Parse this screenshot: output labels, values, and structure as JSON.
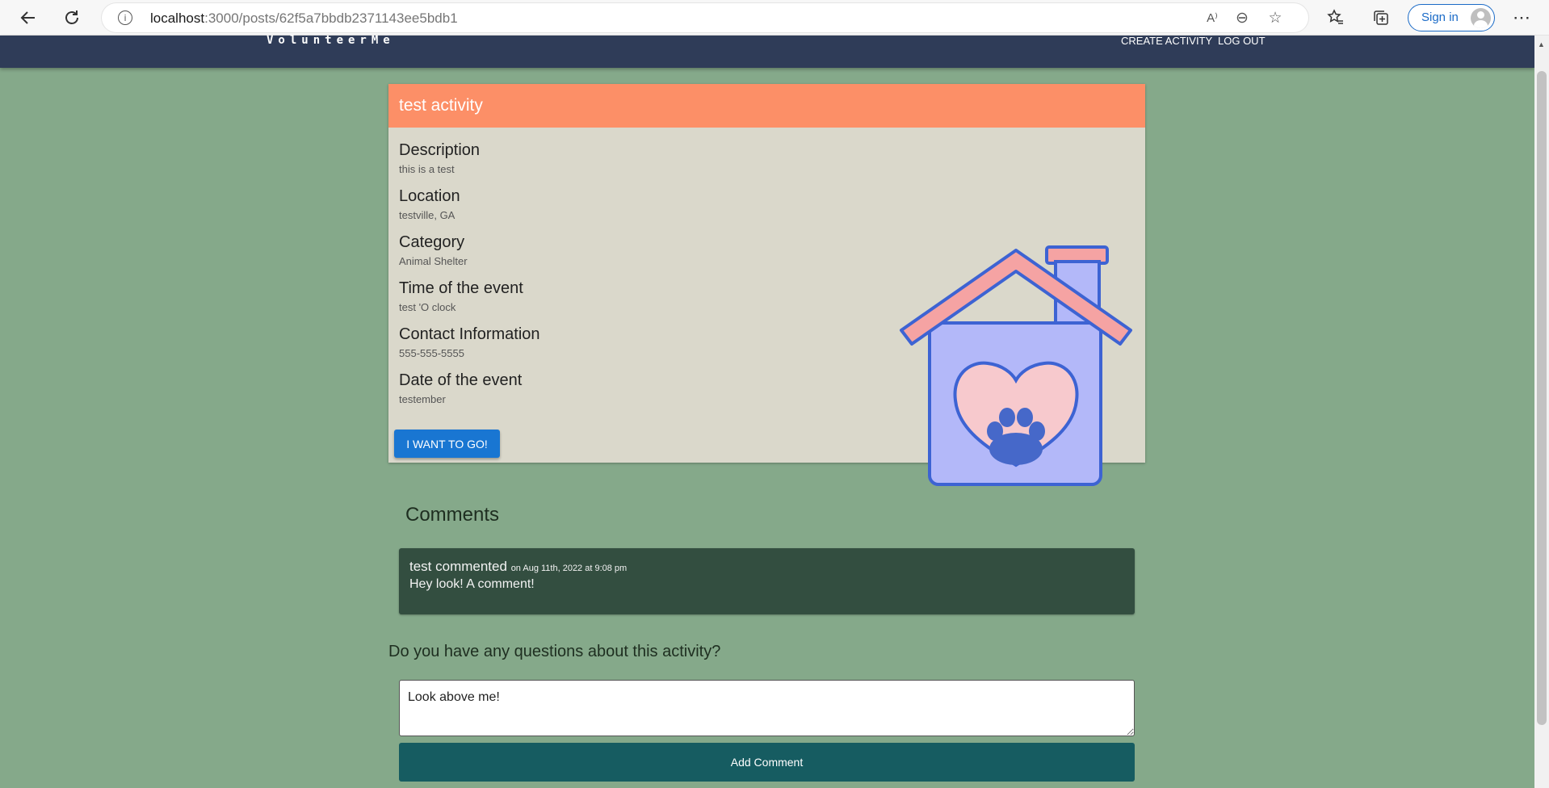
{
  "browser": {
    "url_host": "localhost",
    "url_rest": ":3000/posts/62f5a7bbdb2371143ee5bdb1",
    "signin_label": "Sign in",
    "info_glyph": "i",
    "read_aloud_glyph": "A⁾",
    "zoom_glyph": "⊖",
    "fav_add_glyph": "☆",
    "more_glyph": "⋯"
  },
  "navbar": {
    "brand": "VolunteerMe",
    "links": [
      "CREATE ACTIVITY",
      "LOG OUT"
    ]
  },
  "activity": {
    "title": "test activity",
    "fields": [
      {
        "label": "Description",
        "value": "this is a test"
      },
      {
        "label": "Location",
        "value": "testville, GA"
      },
      {
        "label": "Category",
        "value": "Animal Shelter"
      },
      {
        "label": "Time of the event",
        "value": "test 'O clock"
      },
      {
        "label": "Contact Information",
        "value": "555-555-5555"
      },
      {
        "label": "Date of the event",
        "value": "testember"
      }
    ],
    "go_label": "I WANT TO GO!",
    "image_icon": "animal-shelter-house-icon"
  },
  "comments": {
    "title": "Comments",
    "items": [
      {
        "author": "test commented",
        "date": "on Aug 11th, 2022 at 9:08 pm",
        "text": "Hey look! A comment!"
      }
    ],
    "question": "Do you have any questions about this activity?",
    "input_value": "Look above me!",
    "add_label": "Add Comment"
  },
  "colors": {
    "page_bg": "#85a98a",
    "navbar_bg": "#2f3c58",
    "card_header": "#fc8f67",
    "card_bg": "#dad8cb",
    "go_button": "#1976d2",
    "comment_bg": "#334e40",
    "add_button": "#165c61"
  }
}
